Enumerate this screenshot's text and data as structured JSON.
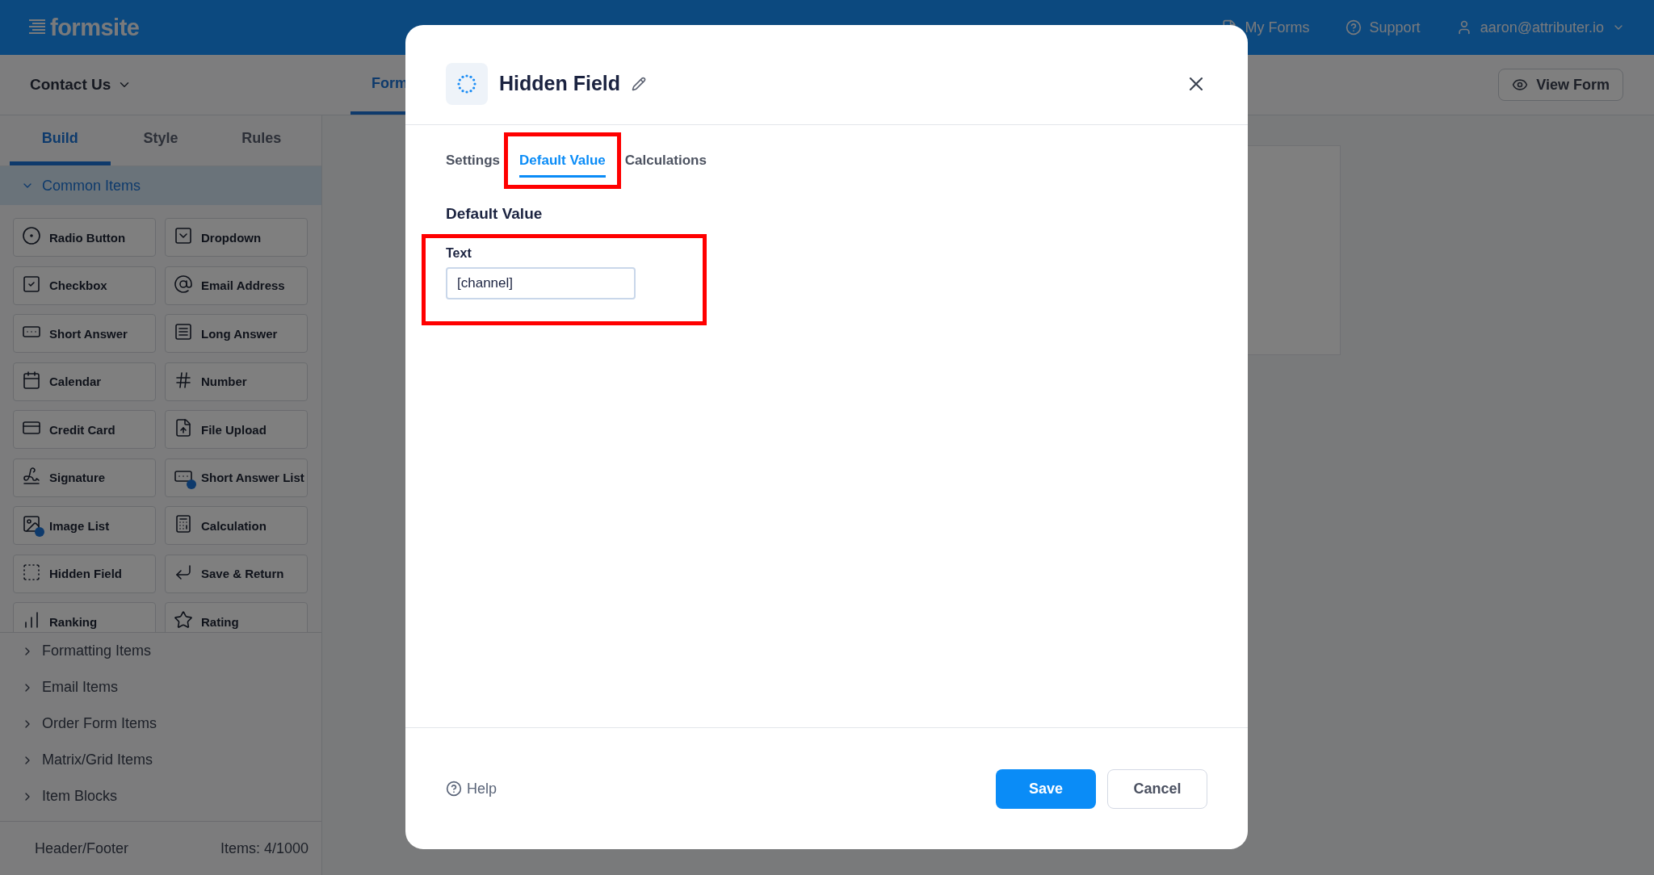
{
  "topbar": {
    "logo": "formsite",
    "links": [
      {
        "label": "My Forms"
      },
      {
        "label": "Support"
      }
    ],
    "account": "aaron@attributer.io"
  },
  "subbar": {
    "form_name": "Contact Us",
    "tabs": [
      {
        "label": "Form",
        "selected": true
      }
    ],
    "view_button": "View Form"
  },
  "sidebar": {
    "tabs": [
      {
        "label": "Build",
        "selected": true
      },
      {
        "label": "Style",
        "selected": false
      },
      {
        "label": "Rules",
        "selected": false
      }
    ],
    "groups": [
      {
        "label": "Common Items",
        "expanded": true,
        "items": [
          "Radio Button",
          "Dropdown",
          "Checkbox",
          "Email Address",
          "Short Answer",
          "Long Answer",
          "Calendar",
          "Number",
          "Credit Card",
          "File Upload",
          "Signature",
          "Short Answer List",
          "Image List",
          "Calculation",
          "Hidden Field",
          "Save & Return",
          "Ranking",
          "Rating"
        ]
      },
      {
        "label": "Formatting Items",
        "expanded": false
      },
      {
        "label": "Email Items",
        "expanded": false
      },
      {
        "label": "Order Form Items",
        "expanded": false
      },
      {
        "label": "Matrix/Grid Items",
        "expanded": false
      },
      {
        "label": "Item Blocks",
        "expanded": false
      }
    ],
    "footer_link": "Header/Footer",
    "item_count": "Items: 4/1000"
  },
  "dialog": {
    "title": "Hidden Field",
    "tabs": [
      {
        "label": "Settings",
        "selected": false,
        "highlighted": false
      },
      {
        "label": "Default Value",
        "selected": true,
        "highlighted": true
      },
      {
        "label": "Calculations",
        "selected": false,
        "highlighted": false
      }
    ],
    "section_title": "Default Value",
    "field": {
      "label": "Text",
      "value": "[channel]",
      "highlighted": true
    },
    "help": "Help",
    "buttons": [
      {
        "label": "Save",
        "kind": "primary"
      },
      {
        "label": "Cancel",
        "kind": "secondary"
      }
    ]
  }
}
